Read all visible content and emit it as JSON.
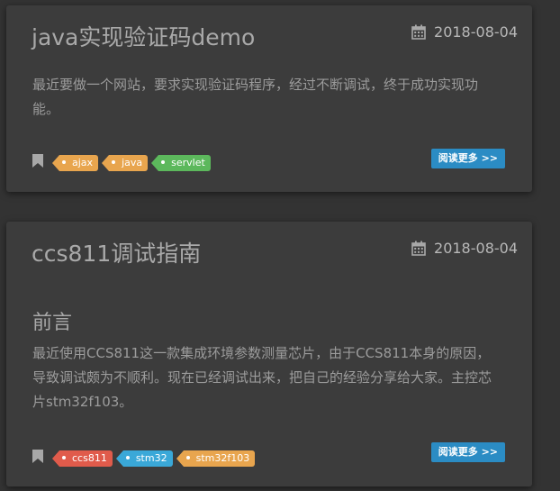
{
  "colors": {
    "tag_orange": "#e8a54e",
    "tag_green": "#5cb85c",
    "tag_red": "#e05b4b",
    "tag_blue": "#3aa8d8",
    "read_more_bg": "#2b8cc4"
  },
  "icons": {
    "date": "calendar-icon",
    "bookmark": "bookmark-icon"
  },
  "posts": [
    {
      "title": "java实现验证码demo",
      "date": "2018-08-04",
      "excerpt": "最近要做一个网站，要求实现验证码程序，经过不断调试，终于成功实现功能。",
      "tags": [
        {
          "label": "ajax",
          "color": "#e8a54e"
        },
        {
          "label": "java",
          "color": "#e8a54e"
        },
        {
          "label": "servlet",
          "color": "#5cb85c"
        }
      ],
      "read_more": "阅读更多 >>"
    },
    {
      "title": "ccs811调试指南",
      "date": "2018-08-04",
      "subheading": "前言",
      "excerpt": "最近使用CCS811这一款集成环境参数测量芯片，由于CCS811本身的原因，导致调试颇为不顺利。现在已经调试出来，把自己的经验分享给大家。主控芯片stm32f103。",
      "tags": [
        {
          "label": "ccs811",
          "color": "#e05b4b"
        },
        {
          "label": "stm32",
          "color": "#3aa8d8"
        },
        {
          "label": "stm32f103",
          "color": "#e8a54e"
        }
      ],
      "read_more": "阅读更多 >>"
    }
  ]
}
